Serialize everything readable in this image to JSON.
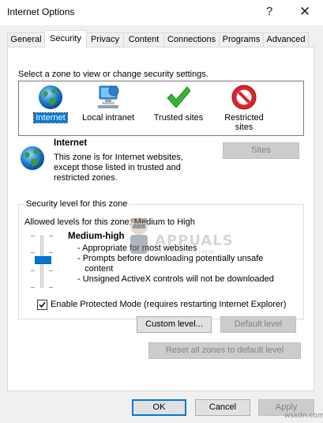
{
  "window": {
    "title": "Internet Options",
    "help_icon": "?",
    "close_icon": "✕"
  },
  "tabs": [
    {
      "label": "General"
    },
    {
      "label": "Security"
    },
    {
      "label": "Privacy"
    },
    {
      "label": "Content"
    },
    {
      "label": "Connections"
    },
    {
      "label": "Programs"
    },
    {
      "label": "Advanced"
    }
  ],
  "active_tab": "Security",
  "security": {
    "instruction": "Select a zone to view or change security settings.",
    "zones": [
      {
        "label": "Internet",
        "icon": "globe-icon",
        "selected": true
      },
      {
        "label": "Local intranet",
        "icon": "intranet-icon"
      },
      {
        "label": "Trusted sites",
        "icon": "checkmark-icon"
      },
      {
        "label": "Restricted sites",
        "label_line1": "Restricted",
        "label_line2": "sites",
        "icon": "no-entry-icon"
      }
    ],
    "zone_info": {
      "name": "Internet",
      "desc_line1": "This zone is for Internet websites,",
      "desc_line2": "except those listed in trusted and",
      "desc_line3": "restricted zones."
    },
    "sites_button": "Sites",
    "level_group": {
      "title": "Security level for this zone",
      "allowed": "Allowed levels for this zone: Medium to High",
      "level_name": "Medium-high",
      "desc": [
        "- Appropriate for most websites",
        "- Prompts before downloading potentially unsafe",
        "   content",
        "- Unsigned ActiveX controls will not be downloaded"
      ],
      "slider_level": 2,
      "slider_levels": 4
    },
    "protected_mode": {
      "label": "Enable Protected Mode (requires restarting Internet Explorer)",
      "checked": true
    },
    "custom_level_button": "Custom level...",
    "default_level_button": "Default level",
    "reset_all_button": "Reset all zones to default level"
  },
  "footer": {
    "ok": "OK",
    "cancel": "Cancel",
    "apply": "Apply"
  },
  "watermark": {
    "brand": "APPUALS",
    "tagline_line1": "TECH HOW-TO'S FROM",
    "tagline_line2": "THE EXPERTS!"
  },
  "credit": "wsxdn.com",
  "colors": {
    "accent": "#0078d7",
    "dialog_bg": "#f0f0f0",
    "panel_bg": "#ffffff"
  }
}
